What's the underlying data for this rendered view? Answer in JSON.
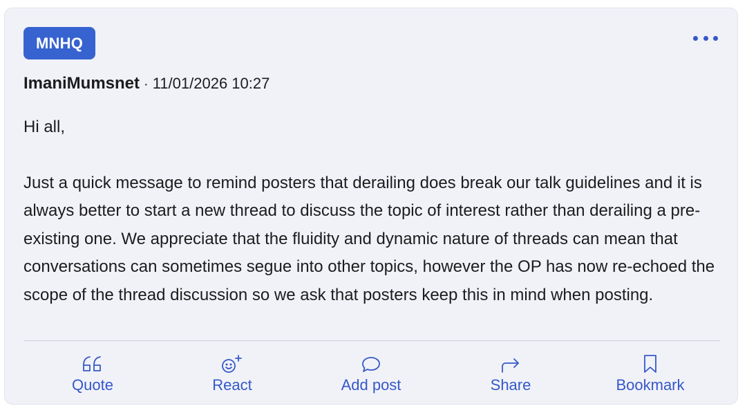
{
  "post": {
    "badge": "MNHQ",
    "author": "ImaniMumsnet",
    "separator": "·",
    "timestamp": "11/01/2026 10:27",
    "paragraphs": [
      "Hi all,",
      "Just a quick message to remind posters that derailing does break our talk guidelines and it is always better to start a new thread to discuss the topic of interest rather than derailing a pre-existing one. We appreciate that the fluidity and dynamic nature of threads can mean that conversations can sometimes segue into other topics, however the OP has now re-echoed the scope of the thread discussion so we ask that posters keep this in mind when posting."
    ]
  },
  "actions": {
    "quote": "Quote",
    "react": "React",
    "add_post": "Add post",
    "share": "Share",
    "bookmark": "Bookmark"
  },
  "icons": {
    "more": "more-options-icon",
    "quote": "quote-icon",
    "react": "add-reaction-icon",
    "add_post": "speech-bubble-icon",
    "share": "share-arrow-icon",
    "bookmark": "bookmark-icon"
  },
  "colors": {
    "accent": "#3558c8",
    "badge_bg": "#3763d0",
    "card_bg": "#f1f2f8"
  }
}
